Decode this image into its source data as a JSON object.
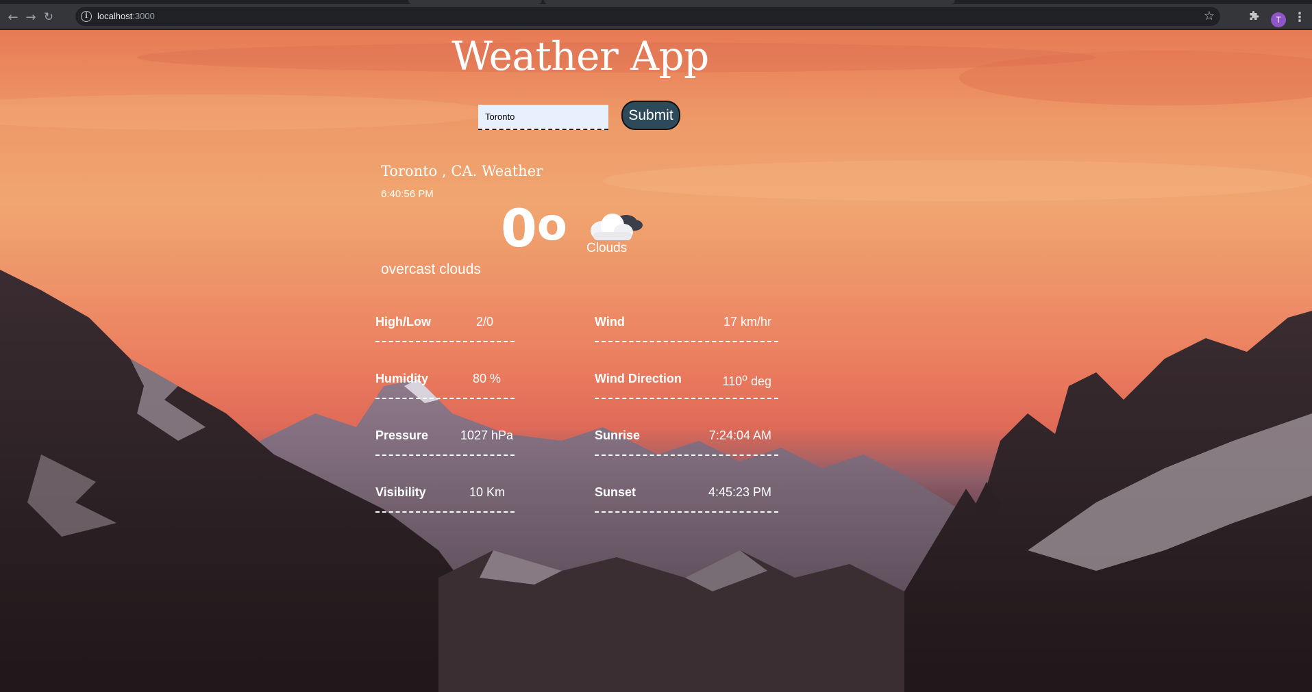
{
  "browser": {
    "url_host": "localhost",
    "url_port": ":3000",
    "avatar_letter": "T",
    "icons": [
      "back-arrow-icon",
      "forward-arrow-icon",
      "reload-icon",
      "info-icon",
      "star-icon",
      "puzzle-icon",
      "kebab-menu-icon"
    ]
  },
  "app": {
    "title": "Weather App",
    "search": {
      "value": "Toronto"
    },
    "submit_label": "Submit"
  },
  "weather": {
    "location": "Toronto , CA. Weather",
    "time": "6:40:56 PM",
    "temperature": "0",
    "degree_mark": "o",
    "condition": "Clouds",
    "description": "overcast clouds",
    "icon": "cloud-icon"
  },
  "stats": {
    "high_low": {
      "label": "High/Low",
      "value": "2/0"
    },
    "humidity": {
      "label": "Humidity",
      "value": "80 %"
    },
    "pressure": {
      "label": "Pressure",
      "value": "1027 hPa"
    },
    "visibility": {
      "label": "Visibility",
      "value": "10 Km"
    },
    "wind": {
      "label": "Wind",
      "value": "17 km/hr"
    },
    "wind_direction": {
      "label": "Wind Direction",
      "value_num": "110",
      "value_sup": "o",
      "value_unit": " deg"
    },
    "sunrise": {
      "label": "Sunrise",
      "value": "7:24:04 AM"
    },
    "sunset": {
      "label": "Sunset",
      "value": "4:45:23 PM"
    }
  },
  "colors": {
    "sky_top": "#e77a55",
    "sky_mid": "#f0a670",
    "mountains": "#2a1f22",
    "button_bg": "#2c4a5a",
    "input_bg": "#e8f0fe"
  }
}
